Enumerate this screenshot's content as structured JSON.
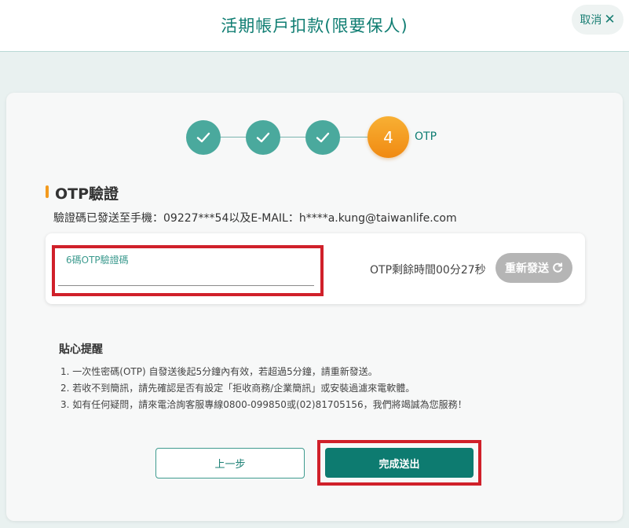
{
  "header": {
    "title": "活期帳戶扣款(限要保人)",
    "cancel_label": "取消"
  },
  "stepper": {
    "current_step": "4",
    "current_label": "OTP",
    "completed_steps": 3
  },
  "otp": {
    "section_title": "OTP驗證",
    "sent_to": "驗證碼已發送至手機：09227***54以及E-MAIL：h****a.kung@taiwanlife.com",
    "field_label": "6碼OTP驗證碼",
    "field_value": "",
    "timer_text": "OTP剩餘時間00分27秒",
    "resend_label": "重新發送"
  },
  "tips": {
    "title": "貼心提醒",
    "items": [
      "1. 一次性密碼(OTP) 自發送後起5分鐘內有效，若超過5分鐘，請重新發送。",
      "2. 若收不到簡訊，請先確認是否有設定「拒收商務/企業簡訊」或安裝過濾來電軟體。",
      "3. 如有任何疑問，請來電洽詢客服專線0800-099850或(02)81705156，我們將竭誠為您服務！"
    ]
  },
  "actions": {
    "prev_label": "上一步",
    "submit_label": "完成送出"
  },
  "colors": {
    "brand_teal": "#0d7b70",
    "step_done": "#4aa99d",
    "step_current": "#f08a12",
    "highlight_red": "#d0202a"
  },
  "icons": {
    "step_done": "check-icon",
    "cancel": "close-icon",
    "resend": "refresh-icon"
  }
}
